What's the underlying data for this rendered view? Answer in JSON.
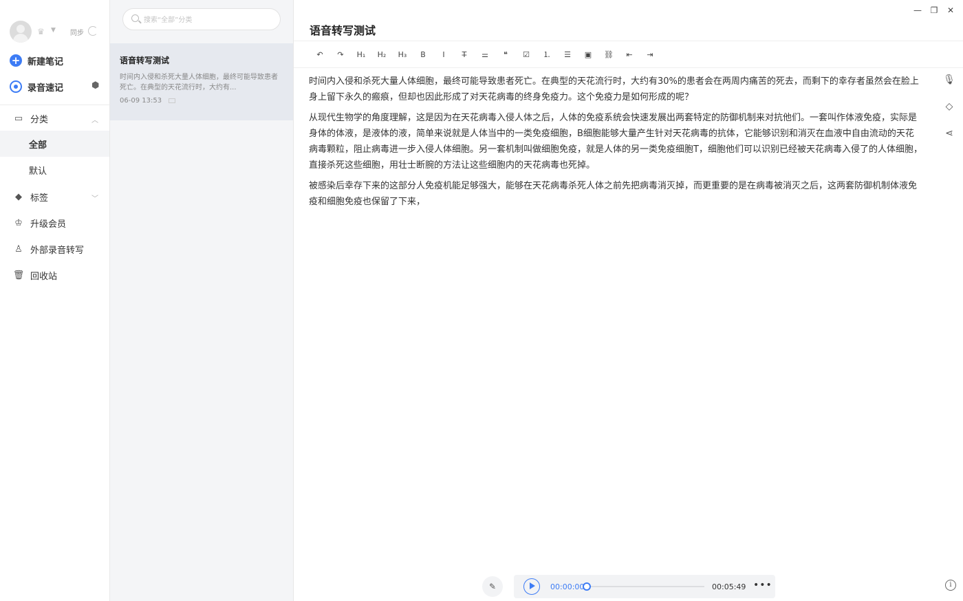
{
  "sidebar": {
    "sync_label": "同步",
    "new_note_label": "新建笔记",
    "record_label": "录音速记",
    "category_label": "分类",
    "category_items": [
      {
        "label": "全部",
        "active": true
      },
      {
        "label": "默认",
        "active": false
      }
    ],
    "tags_label": "标签",
    "upgrade_label": "升级会员",
    "external_label": "外部录音转写",
    "trash_label": "回收站",
    "icons": {
      "new_note": "plus-circle-icon",
      "record": "record-ring-icon",
      "category": "folder-icon",
      "tags": "tag-icon",
      "upgrade": "crown-icon",
      "external": "microphone-stand-icon",
      "trash": "trash-icon"
    }
  },
  "list": {
    "search_placeholder": "搜索“全部”分类",
    "notes": [
      {
        "title": "语音转写测试",
        "snippet": "时间内入侵和杀死大量人体细胞，最终可能导致患者死亡。在典型的天花流行时，大约有...",
        "date": "06-09 13:53"
      }
    ]
  },
  "editor": {
    "title": "语音转写测试",
    "toolbar": [
      {
        "name": "undo-icon",
        "glyph": "↶"
      },
      {
        "name": "redo-icon",
        "glyph": "↷"
      },
      {
        "name": "heading1-icon",
        "glyph": "H₁"
      },
      {
        "name": "heading2-icon",
        "glyph": "H₂"
      },
      {
        "name": "heading3-icon",
        "glyph": "H₃"
      },
      {
        "name": "bold-icon",
        "glyph": "B"
      },
      {
        "name": "italic-icon",
        "glyph": "I"
      },
      {
        "name": "strikethrough-icon",
        "glyph": "T̶"
      },
      {
        "name": "divider-icon",
        "glyph": "⚌"
      },
      {
        "name": "quote-icon",
        "glyph": "❝"
      },
      {
        "name": "checkbox-icon",
        "glyph": "☑"
      },
      {
        "name": "ordered-list-icon",
        "glyph": "⒈"
      },
      {
        "name": "bullet-list-icon",
        "glyph": "☰"
      },
      {
        "name": "image-icon",
        "glyph": "▣"
      },
      {
        "name": "link-icon",
        "glyph": "⛓"
      },
      {
        "name": "outdent-icon",
        "glyph": "⇤"
      },
      {
        "name": "indent-icon",
        "glyph": "⇥"
      }
    ],
    "paragraphs": [
      "时间内入侵和杀死大量人体细胞，最终可能导致患者死亡。在典型的天花流行时，大约有30%的患者会在两周内痛苦的死去，而剩下的幸存者虽然会在脸上身上留下永久的瘢痕，但却也因此形成了对天花病毒的终身免疫力。这个免疫力是如何形成的呢？",
      "从现代生物学的角度理解，这是因为在天花病毒入侵人体之后，人体的免疫系统会快速发展出两套特定的防御机制来对抗他们。一套叫作体液免疫，实际是身体的体液，是液体的液，简单来说就是人体当中的一类免疫细胞，B细胞能够大量产生针对天花病毒的抗体，它能够识别和消灭在血液中自由流动的天花病毒颗粒，阻止病毒进一步入侵人体细胞。另一套机制叫做细胞免疫，就是人体的另一类免疫细胞T，细胞他们可以识别已经被天花病毒入侵了的人体细胞，直接杀死这些细胞，用壮士断腕的方法让这些细胞内的天花病毒也死掉。",
      "被感染后幸存下来的这部分人免疫机能足够强大，能够在天花病毒杀死人体之前先把病毒消灭掉，而更重要的是在病毒被消灭之后，这两套防御机制体液免疫和细胞免疫也保留了下来，"
    ],
    "player": {
      "current_time": "00:00:00",
      "duration": "00:05:49",
      "progress": 0.0
    }
  },
  "colors": {
    "accent": "#3d7cf5",
    "list_bg": "#f4f5f7",
    "selected_note_bg": "#e6e9ef"
  }
}
